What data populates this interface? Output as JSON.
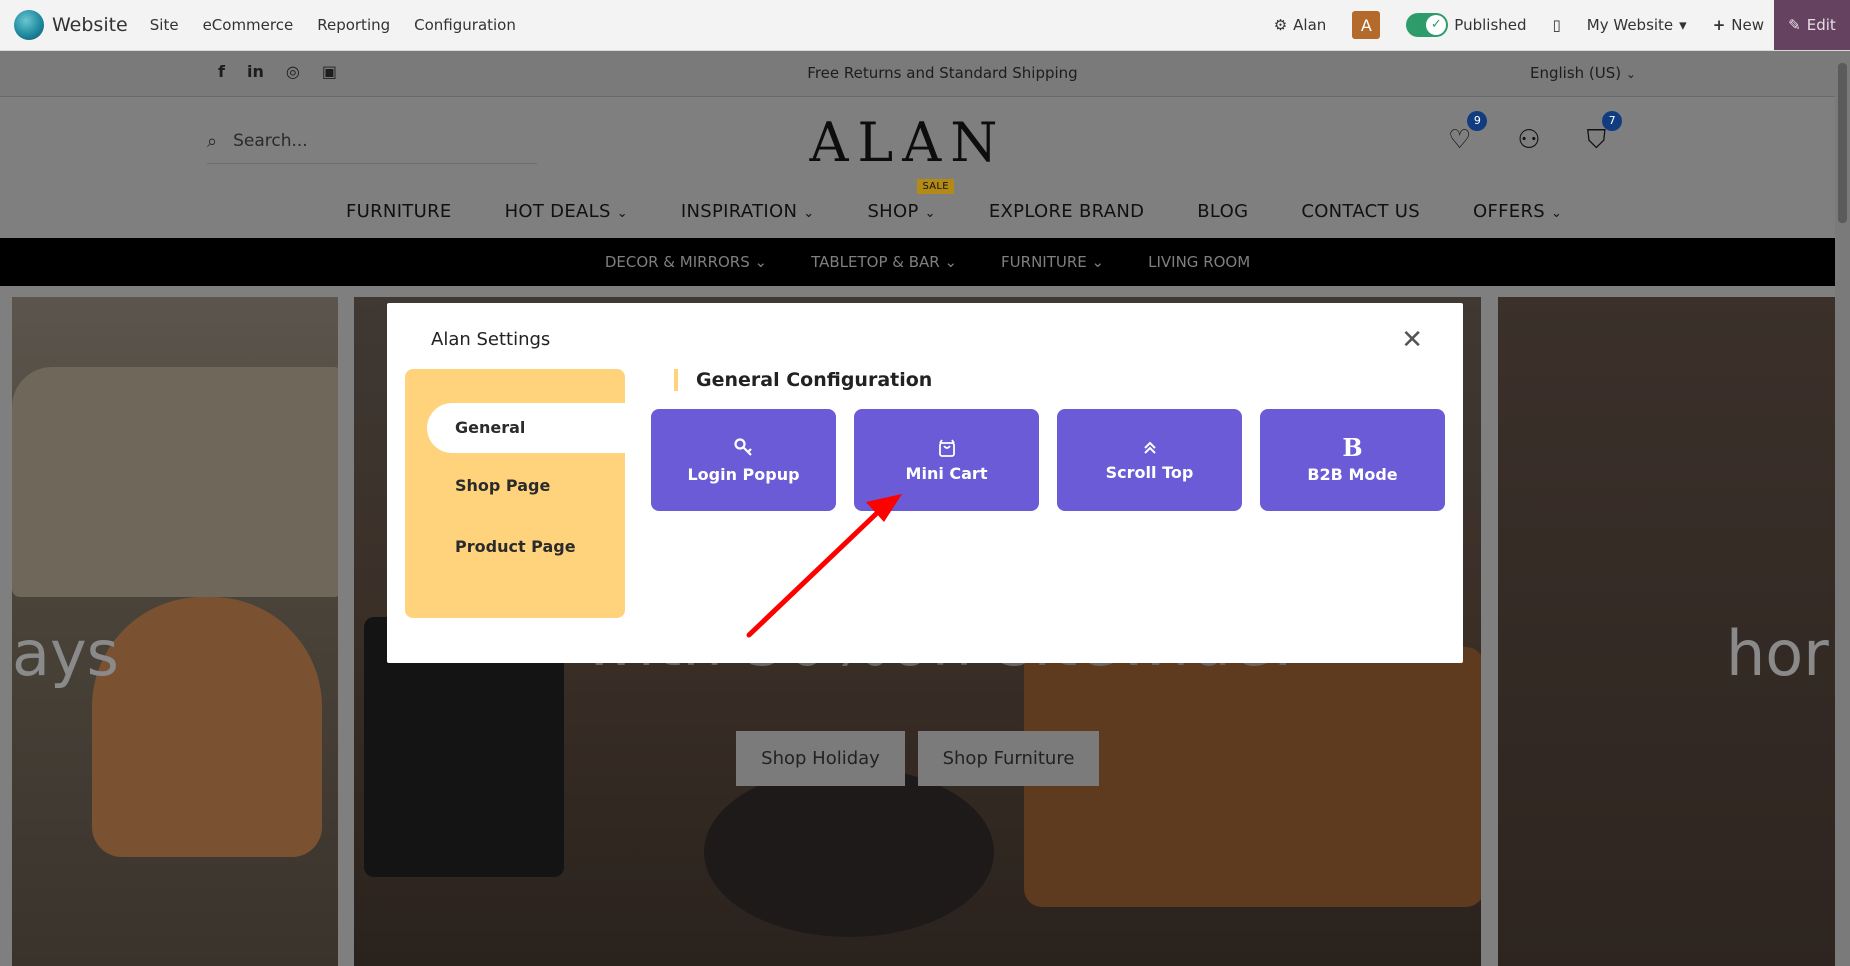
{
  "adminbar": {
    "app_name": "Website",
    "menus": [
      "Site",
      "eCommerce",
      "Reporting",
      "Configuration"
    ],
    "user": "Alan",
    "avatar_letter": "A",
    "published_label": "Published",
    "website_label": "My Website",
    "new_label": "New",
    "edit_label": "Edit"
  },
  "topstrip": {
    "promo": "Free Returns and Standard Shipping",
    "language": "English (US)"
  },
  "header": {
    "search_placeholder": "Search...",
    "brand": "ALAN",
    "wishlist_count": "9",
    "cart_count": "7"
  },
  "nav": {
    "items": [
      "FURNITURE",
      "HOT DEALS",
      "INSPIRATION",
      "SHOP",
      "EXPLORE BRAND",
      "BLOG",
      "CONTACT US",
      "OFFERS"
    ],
    "sale_tag": "SALE"
  },
  "subnav": {
    "items": [
      "DECOR & MIRRORS",
      "TABLETOP & BAR",
      "FURNITURE",
      "LIVING ROOM"
    ]
  },
  "hero": {
    "left_text": "ays",
    "center_text": "with 50%off sitewide.",
    "right_text": "hor",
    "buttons": [
      "Shop Holiday",
      "Shop Furniture"
    ]
  },
  "modal": {
    "title": "Alan Settings",
    "sidebar": [
      "General",
      "Shop Page",
      "Product Page"
    ],
    "section_title": "General Configuration",
    "cards": [
      {
        "label": "Login Popup",
        "icon": "key-icon"
      },
      {
        "label": "Mini Cart",
        "icon": "bag-icon"
      },
      {
        "label": "Scroll Top",
        "icon": "double-chevron-up-icon"
      },
      {
        "label": "B2B Mode",
        "icon": "bold-b-icon"
      }
    ]
  },
  "colors": {
    "card_purple": "#6b5bd6",
    "sidebar_yellow": "#ffd37b",
    "arrow_red": "#ff0000",
    "edit_purple": "#65425f"
  }
}
